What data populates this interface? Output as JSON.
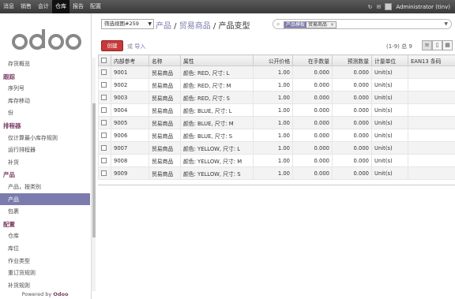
{
  "topbar": {
    "menu": [
      {
        "label": "消息",
        "active": false
      },
      {
        "label": "销售",
        "active": false
      },
      {
        "label": "会计",
        "active": false
      },
      {
        "label": "仓库",
        "active": true
      },
      {
        "label": "报告",
        "active": false
      },
      {
        "label": "配置",
        "active": false
      }
    ],
    "user": "Administrator (tinv)"
  },
  "sidebar": {
    "logo_text": "odoo",
    "menu": [
      {
        "type": "item",
        "label": "存货概览"
      },
      {
        "type": "section",
        "label": "跟踪"
      },
      {
        "type": "item",
        "label": "序列号"
      },
      {
        "type": "item",
        "label": "库存移动"
      },
      {
        "type": "item",
        "label": "份"
      },
      {
        "type": "section",
        "label": "排程器"
      },
      {
        "type": "item",
        "label": "仅计算最小库存规则"
      },
      {
        "type": "item",
        "label": "运行排程器"
      },
      {
        "type": "item",
        "label": "补货"
      },
      {
        "type": "section",
        "label": "产品"
      },
      {
        "type": "item",
        "label": "产品，按类别"
      },
      {
        "type": "item",
        "label": "产品",
        "selected": true
      },
      {
        "type": "item",
        "label": "包裹"
      },
      {
        "type": "section",
        "label": "配置"
      },
      {
        "type": "item",
        "label": "仓库"
      },
      {
        "type": "item",
        "label": "库位"
      },
      {
        "type": "item",
        "label": "作业类型"
      },
      {
        "type": "item",
        "label": "重订货规则"
      },
      {
        "type": "item",
        "label": "补货规则"
      }
    ],
    "powered_prefix": "Powered by ",
    "powered_brand": "Odoo"
  },
  "header": {
    "view_select": "筛选视图#259",
    "breadcrumb": [
      {
        "label": "产品",
        "link": true
      },
      {
        "label": " / ",
        "link": false
      },
      {
        "label": "贸易商品",
        "link": true
      },
      {
        "label": " / 产品变型",
        "link": false
      }
    ],
    "search": {
      "facet_category": "产品模板",
      "facet_value": "贸易商品",
      "facet_remove": "×"
    },
    "create_label": "创建",
    "or_label": "或",
    "import_label": "导入",
    "pager": "(1-9) 总 9"
  },
  "table": {
    "columns": [
      "内部参考",
      "名称",
      "属性",
      "公开价格",
      "在手数量",
      "预测数量",
      "计量单位",
      "EAN13 条码"
    ],
    "rows": [
      [
        "9001",
        "贸易商品",
        "颜色: RED, 尺寸: L",
        "1.00",
        "0.000",
        "0.000",
        "Unit(s)",
        ""
      ],
      [
        "9002",
        "贸易商品",
        "颜色: RED, 尺寸: M",
        "1.00",
        "0.000",
        "0.000",
        "Unit(s)",
        ""
      ],
      [
        "9003",
        "贸易商品",
        "颜色: RED, 尺寸: S",
        "1.00",
        "0.000",
        "0.000",
        "Unit(s)",
        ""
      ],
      [
        "9004",
        "贸易商品",
        "颜色: BLUE, 尺寸: L",
        "1.00",
        "0.000",
        "0.000",
        "Unit(s)",
        ""
      ],
      [
        "9005",
        "贸易商品",
        "颜色: BLUE, 尺寸: M",
        "1.00",
        "0.000",
        "0.000",
        "Unit(s)",
        ""
      ],
      [
        "9006",
        "贸易商品",
        "颜色: BLUE, 尺寸: S",
        "1.00",
        "0.000",
        "0.000",
        "Unit(s)",
        ""
      ],
      [
        "9007",
        "贸易商品",
        "颜色: YELLOW, 尺寸: L",
        "1.00",
        "0.000",
        "0.000",
        "Unit(s)",
        ""
      ],
      [
        "9008",
        "贸易商品",
        "颜色: YELLOW, 尺寸: M",
        "1.00",
        "0.000",
        "0.000",
        "Unit(s)",
        ""
      ],
      [
        "9009",
        "贸易商品",
        "颜色: YELLOW, 尺寸: S",
        "1.00",
        "0.000",
        "0.000",
        "Unit(s)",
        ""
      ]
    ]
  },
  "colors": {
    "brand": "#7c3e66",
    "accent": "#7c7bad",
    "create": "#c83a3a"
  }
}
